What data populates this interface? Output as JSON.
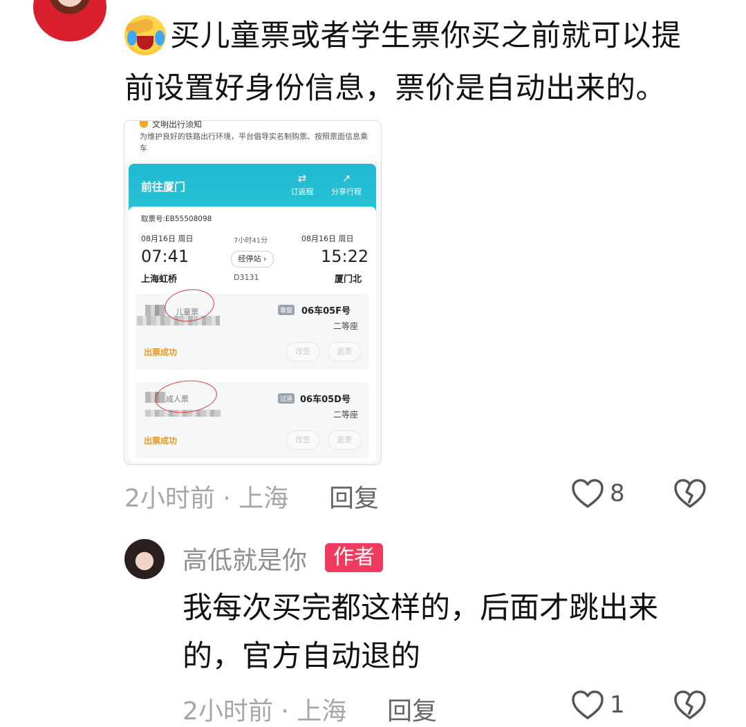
{
  "comment1": {
    "emoji": "laughing-crying-emoji",
    "text_line1": "买儿童票或者学生票你买之前就可以提",
    "text_line2": "前设置好身份信息，票价是自动出来的。",
    "time_location": "2小时前 · 上海",
    "reply_label": "回复",
    "like_count": "8"
  },
  "screenshot": {
    "notice_title": "文明出行须知",
    "notice_text": "为维护良好的铁路出行环境，平台倡导实名制购票、按照票面信息乘车",
    "header_title": "前往厦门",
    "action_return": "订返程",
    "action_share": "分享行程",
    "ticket_number": "取票号:EB55508098",
    "depart_date": "08月16日 周日",
    "arrive_date": "08月16日 周日",
    "duration": "7小时41分",
    "depart_time": "07:41",
    "arrive_time": "15:22",
    "stops_button": "经停站 ›",
    "depart_station": "上海虹桥",
    "arrive_station": "厦门北",
    "train_number": "D3131",
    "passengers": [
      {
        "ticket_type": "儿童票",
        "seat_tag": "靠窗",
        "seat": "06车05F号",
        "class": "二等座",
        "status": "出票成功",
        "change": "改签",
        "refund": "退票"
      },
      {
        "ticket_type": "成人票",
        "seat_tag": "过道",
        "seat": "06车05D号",
        "class": "二等座",
        "status": "出票成功",
        "change": "改签",
        "refund": "退票"
      }
    ]
  },
  "comment2": {
    "username": "高低就是你",
    "badge": "作者",
    "text_line1": "我每次买完都这样的，后面才跳出来",
    "text_line2": "的，官方自动退的",
    "time_location": "2小时前 · 上海",
    "reply_label": "回复",
    "like_count": "1"
  },
  "colors": {
    "author_badge": "#f03a5f",
    "header_teal": "#20b8d2",
    "status_orange": "#e59a2b"
  }
}
